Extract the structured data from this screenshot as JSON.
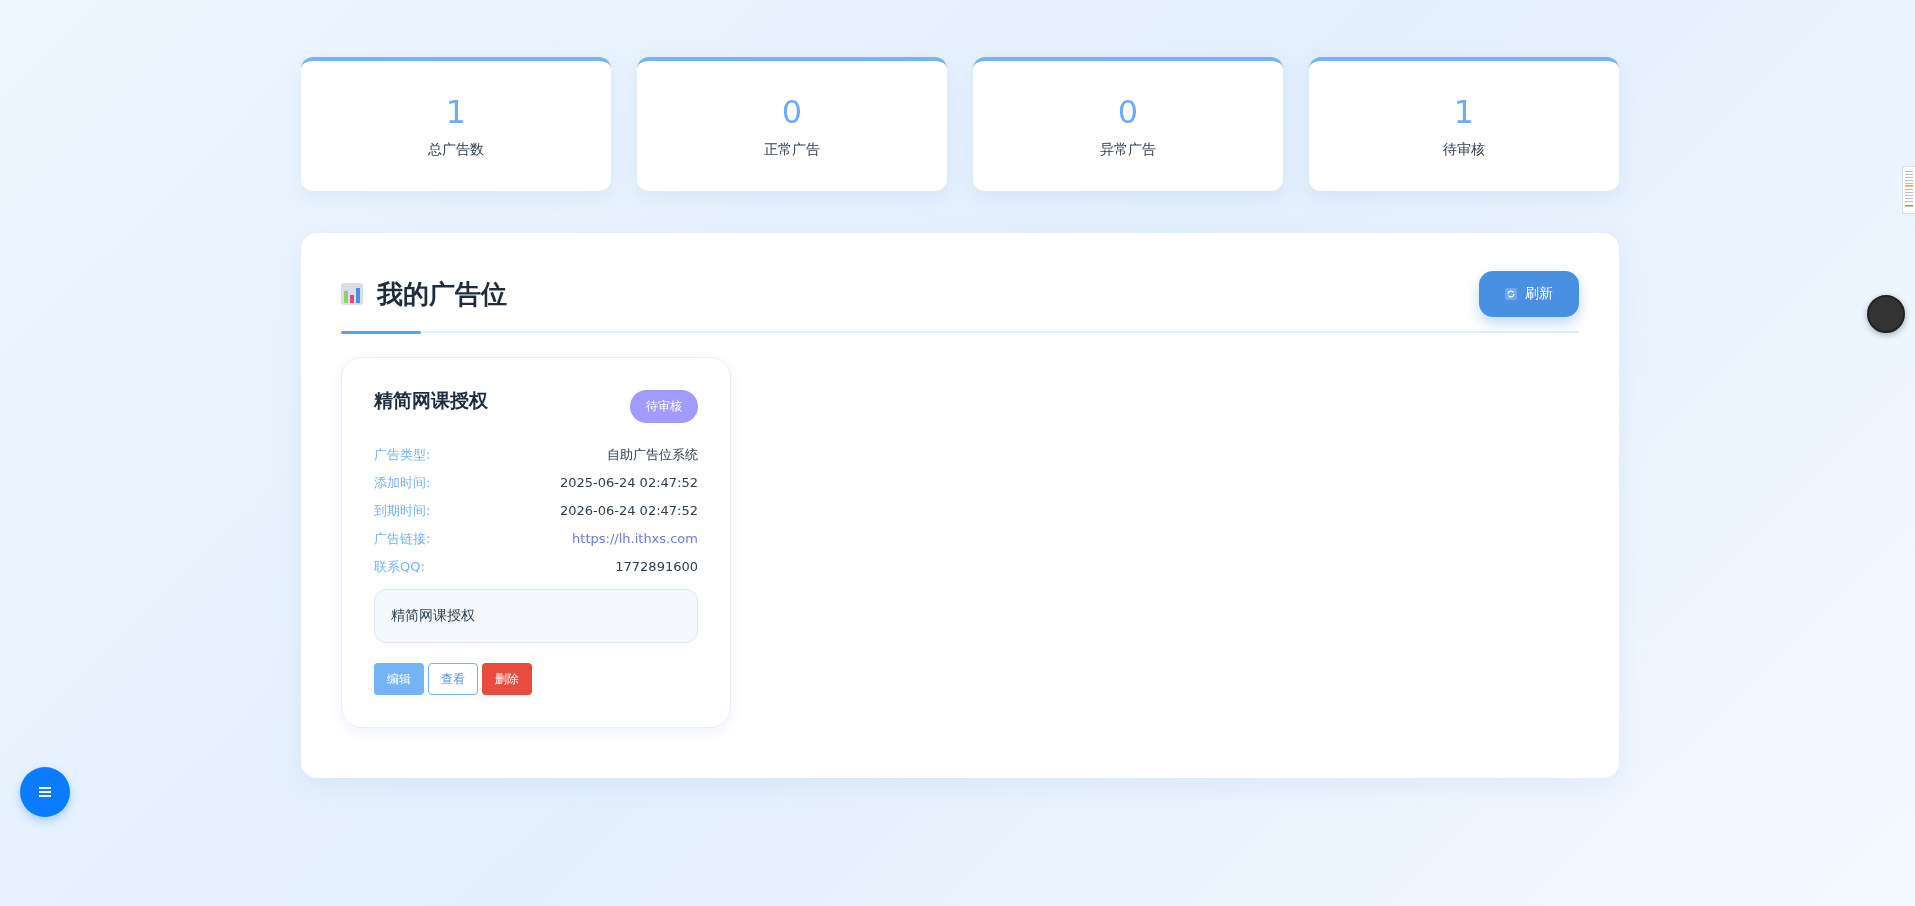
{
  "stats": [
    {
      "value": "1",
      "label": "总广告数"
    },
    {
      "value": "0",
      "label": "正常广告"
    },
    {
      "value": "0",
      "label": "异常广告"
    },
    {
      "value": "1",
      "label": "待审核"
    }
  ],
  "panel": {
    "title": "我的广告位",
    "refresh_button": "刷新"
  },
  "ads": [
    {
      "title": "精简网课授权",
      "status": {
        "label": "待审核",
        "kind": "pending"
      },
      "fields": [
        {
          "label": "广告类型:",
          "value": "自助广告位系统",
          "kind": "text"
        },
        {
          "label": "添加时间:",
          "value": "2025-06-24 02:47:52",
          "kind": "text"
        },
        {
          "label": "到期时间:",
          "value": "2026-06-24 02:47:52",
          "kind": "text"
        },
        {
          "label": "广告链接:",
          "value": "https://lh.ithxs.com",
          "kind": "link"
        },
        {
          "label": "联系QQ:",
          "value": "1772891600",
          "kind": "text"
        }
      ],
      "description": "精简网课授权",
      "actions": [
        {
          "label": "编辑",
          "kind": "edit"
        },
        {
          "label": "查看",
          "kind": "view"
        },
        {
          "label": "删除",
          "kind": "delete"
        }
      ]
    }
  ]
}
